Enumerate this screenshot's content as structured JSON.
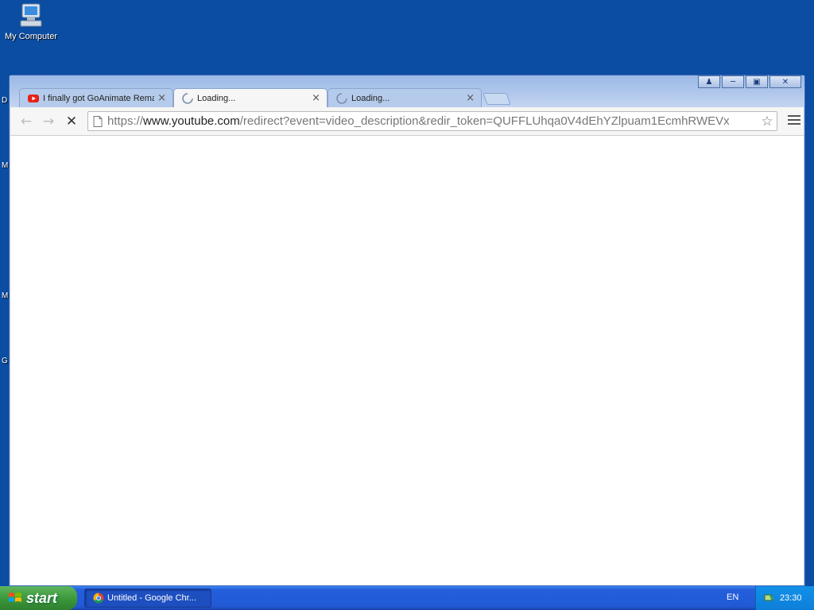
{
  "desktop": {
    "icons": [
      {
        "label": "My Computer",
        "icon": "my-computer-icon"
      }
    ],
    "edge_letters": [
      "D",
      "M",
      "M",
      "G"
    ]
  },
  "window": {
    "controls": {
      "user": "user-profile-icon",
      "minimize": "minimize-icon",
      "maximize": "maximize-icon",
      "close": "close-icon"
    },
    "tabs": [
      {
        "title": "I finally got GoAnimate Rema",
        "icon": "youtube-icon",
        "active": false
      },
      {
        "title": "Loading...",
        "icon": "loading-spinner-icon",
        "active": true
      },
      {
        "title": "Loading...",
        "icon": "loading-spinner-icon",
        "active": false
      }
    ],
    "toolbar": {
      "back": "back-arrow-icon",
      "forward": "forward-arrow-icon",
      "stop": "stop-icon",
      "url_scheme": "https://",
      "url_host": "www.youtube.com",
      "url_rest": "/redirect?event=video_description&redir_token=QUFFLUhqa0V4dEhYZlpuam1EcmhRWEVx",
      "bookmark": "star-icon",
      "menu": "menu-icon"
    }
  },
  "taskbar": {
    "start_label": "start",
    "task_label": "Untitled - Google Chr...",
    "language": "EN",
    "clock": "23:30"
  },
  "colors": {
    "desktop": "#0a4da3",
    "taskbar": "#245edb",
    "start_button": "#3c9a3c",
    "youtube_red": "#e62117"
  }
}
